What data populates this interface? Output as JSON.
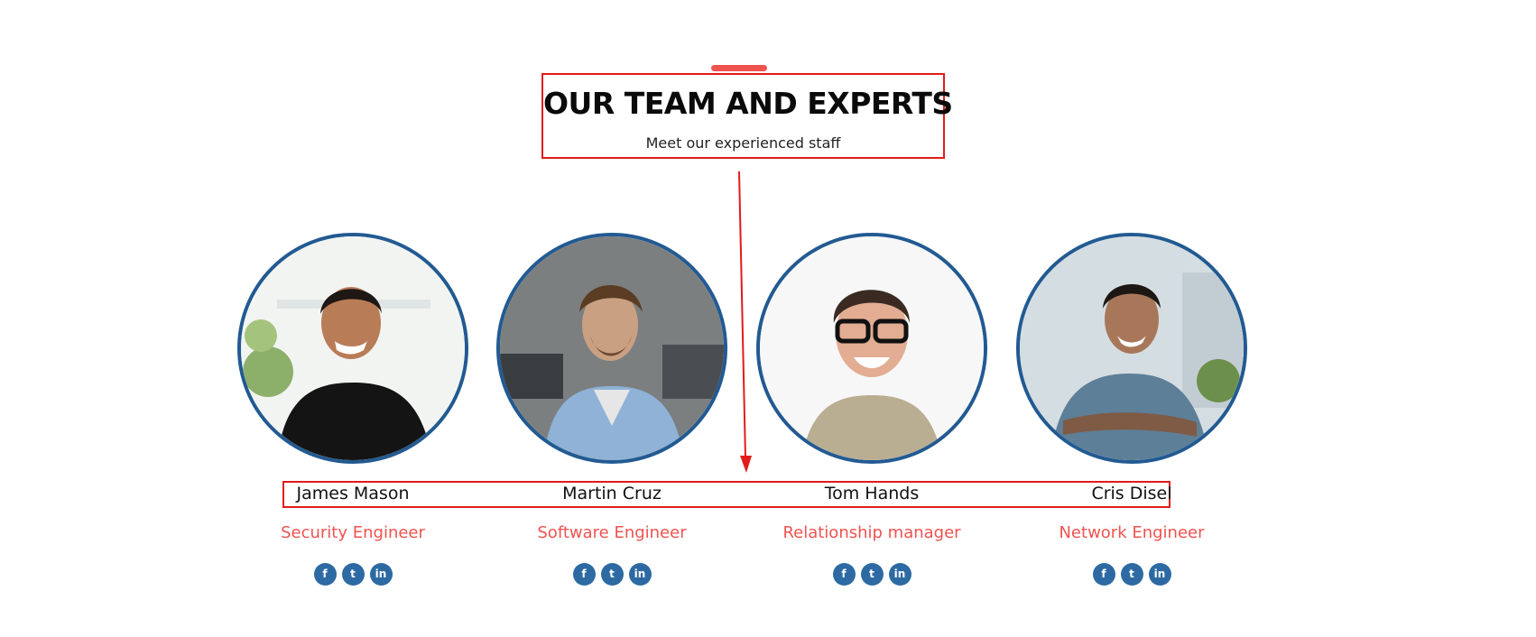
{
  "section": {
    "title": "OUR TEAM AND EXPERTS",
    "subtitle": "Meet our experienced staff"
  },
  "colors": {
    "accent": "#ef5350",
    "ring": "#225a92",
    "social": "#2d6aa3",
    "annotation": "#e21b1b"
  },
  "team": [
    {
      "name": "James Mason",
      "role": "Security Engineer"
    },
    {
      "name": "Martin Cruz",
      "role": "Software Engineer"
    },
    {
      "name": "Tom Hands",
      "role": "Relationship manager"
    },
    {
      "name": "Cris Disel",
      "role": "Network Engineer"
    }
  ],
  "social_icons": {
    "facebook": "f",
    "twitter": "t",
    "linkedin": "in"
  }
}
